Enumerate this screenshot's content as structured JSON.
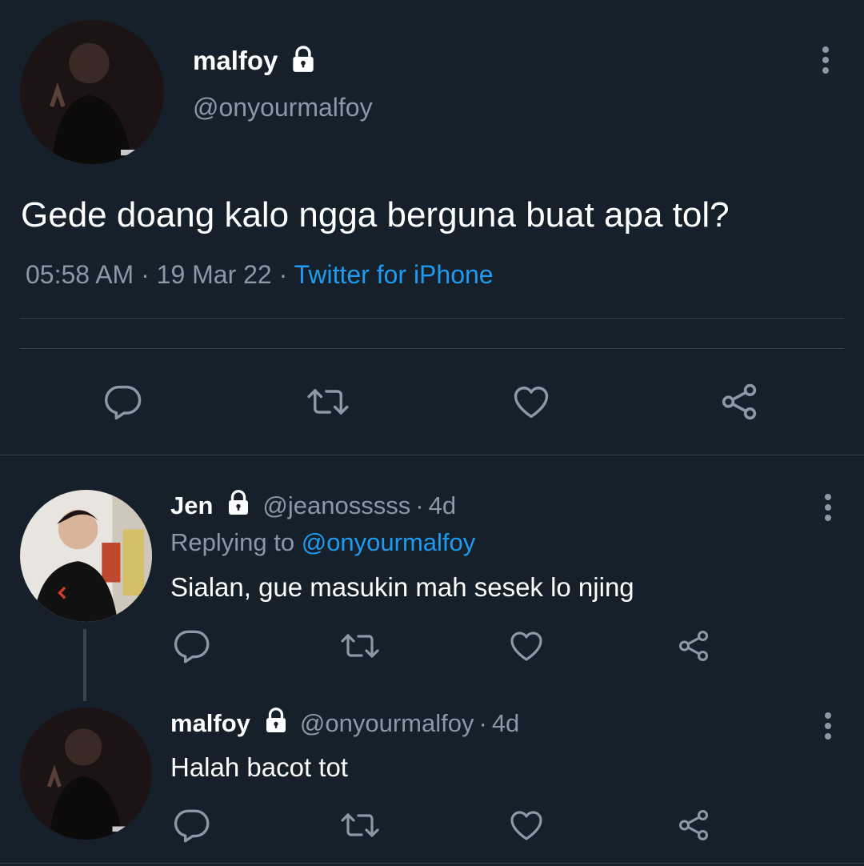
{
  "main_tweet": {
    "display_name": "malfoy",
    "handle": "@onyourmalfoy",
    "text": "Gede doang kalo ngga berguna buat apa tol?",
    "time": "05:58 AM",
    "sep1": "·",
    "date": "19 Mar 22",
    "sep2": "·",
    "source": "Twitter for iPhone",
    "avatar_icon": "user-avatar",
    "lock_icon": "lock-icon",
    "more_icon": "more-vertical-icon"
  },
  "replies": [
    {
      "display_name": "Jen",
      "handle": "@jeanosssss",
      "sep": "·",
      "age": "4d",
      "replying_label": "Replying to",
      "replying_to": "@onyourmalfoy",
      "text": "Sialan, gue masukin mah sesek lo njing"
    },
    {
      "display_name": "malfoy",
      "handle": "@onyourmalfoy",
      "sep": "·",
      "age": "4d",
      "text": "Halah bacot tot"
    }
  ],
  "actions": [
    "reply-icon",
    "retweet-icon",
    "like-icon",
    "share-icon"
  ],
  "colors": {
    "background": "#15202b",
    "text": "#ffffff",
    "muted": "#8b98a5",
    "link": "#1d9bf0",
    "divider": "#38444d"
  }
}
